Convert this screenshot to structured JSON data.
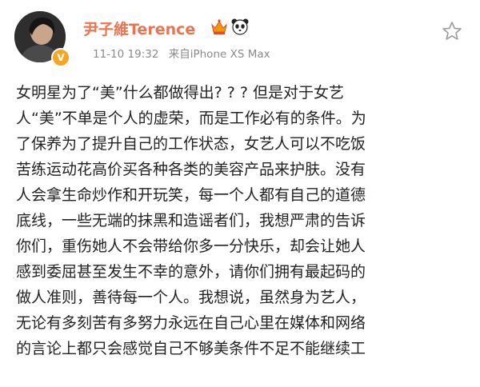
{
  "post": {
    "author": {
      "name": "尹子維Terence",
      "badges": [
        "vip-crown-icon",
        "panda-icon"
      ],
      "verified": true,
      "verified_color": "#f5a623",
      "name_color": "#eb7350"
    },
    "timestamp": "11-10 19:32",
    "source": "来自iPhone XS Max",
    "body_lines": [
      "女明星为了“美”什么都做得出? ? ? 但是对于女艺",
      "人“美”不单是个人的虚荣，而是工作必有的条件。为",
      "了保养为了提升自己的工作状态，女艺人可以不吃饭",
      "苦练运动花高价买各种各类的美容产品来护肤。没有",
      "人会拿生命炒作和开玩笑，每一个人都有自己的道德",
      "底线，一些无端的抹黑和造谣者们，我想严肃的告诉",
      "你们，重伤她人不会带给你多一分快乐，却会让她人",
      "感到委屈甚至发生不幸的意外，请你们拥有最起码的",
      "做人准则，善待每一个人。我想说，虽然身为艺人，",
      "无论有多刻苦有多努力永远在自己心里在媒体和网络",
      "的言论上都只会感觉自己不够美条件不足不能继续工"
    ]
  }
}
